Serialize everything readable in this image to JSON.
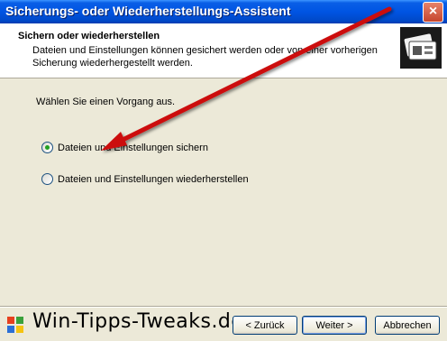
{
  "window": {
    "title": "Sicherungs- oder Wiederherstellungs-Assistent",
    "close_label": "×"
  },
  "header": {
    "title": "Sichern oder wiederherstellen",
    "subtitle": "Dateien und Einstellungen können gesichert werden oder von einer vorherigen Sicherung wiederhergestellt werden.",
    "icon": "backup-wizard-icon"
  },
  "content": {
    "prompt": "Wählen Sie einen Vorgang aus.",
    "options": [
      {
        "label": "Dateien und Einstellungen sichern",
        "selected": true
      },
      {
        "label": "Dateien und Einstellungen wiederherstellen",
        "selected": false
      }
    ]
  },
  "footer": {
    "brand": "Win-Tipps-Tweaks.de",
    "back_label": "< Zurück",
    "next_label": "Weiter >",
    "cancel_label": "Abbrechen"
  },
  "annotation": {
    "color": "#cc1111"
  }
}
